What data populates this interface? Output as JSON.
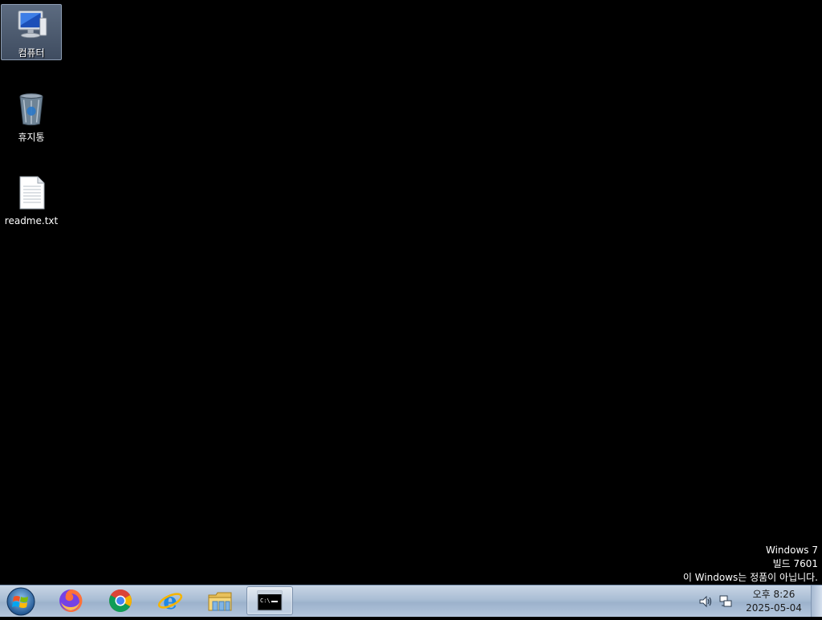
{
  "desktop": {
    "icons": [
      {
        "label": "컴퓨터",
        "icon": "computer-icon",
        "selected": true
      },
      {
        "label": "휴지통",
        "icon": "recycle-bin-icon",
        "selected": false
      },
      {
        "label": "readme.txt",
        "icon": "text-file-icon",
        "selected": false
      }
    ],
    "watermark": {
      "line1": "Windows 7",
      "line2": "빌드 7601",
      "line3": "이 Windows는 정품이 아닙니다."
    }
  },
  "taskbar": {
    "start": {
      "icon": "windows-start-icon"
    },
    "apps": [
      {
        "icon": "firefox-icon",
        "active": false
      },
      {
        "icon": "chrome-icon",
        "active": false
      },
      {
        "icon": "internet-explorer-icon",
        "active": false
      },
      {
        "icon": "file-explorer-icon",
        "active": false
      },
      {
        "icon": "command-prompt-icon",
        "active": true
      }
    ],
    "tray": {
      "icons": [
        "volume-icon",
        "network-icon"
      ],
      "clock": {
        "time": "오후 8:26",
        "date": "2025-05-04"
      }
    }
  },
  "colors": {
    "desktop_bg": "#000000",
    "taskbar_bg": "#a9bdd4",
    "selection": "#4d5b70"
  }
}
